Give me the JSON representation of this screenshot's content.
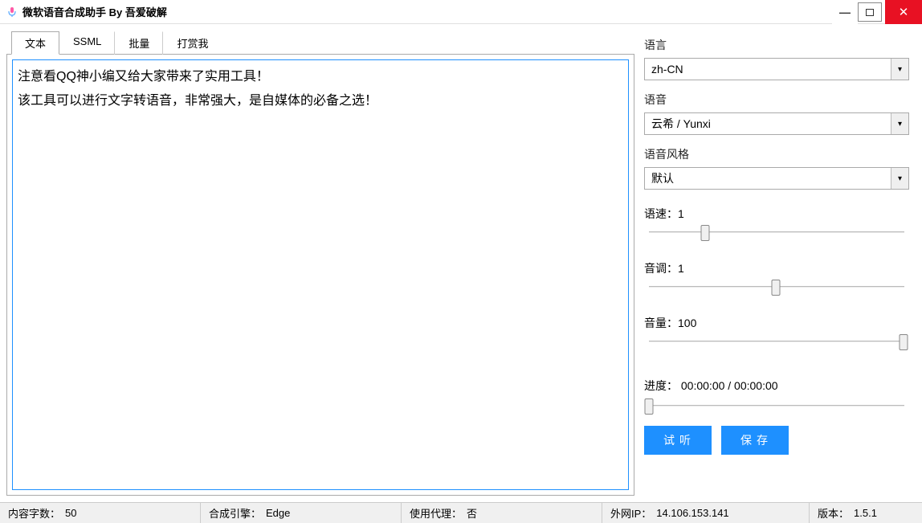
{
  "window": {
    "title": "微软语音合成助手 By 吾爱破解"
  },
  "tabs": [
    {
      "label": "文本"
    },
    {
      "label": "SSML"
    },
    {
      "label": "批量"
    },
    {
      "label": "打赏我"
    }
  ],
  "editor": {
    "text": "注意看QQ神小编又给大家带来了实用工具！\n该工具可以进行文字转语音，非常强大，是自媒体的必备之选！"
  },
  "sidebar": {
    "language": {
      "label": "语言",
      "value": "zh-CN"
    },
    "voice": {
      "label": "语音",
      "value": "云希 / Yunxi"
    },
    "style": {
      "label": "语音风格",
      "value": "默认"
    },
    "rate": {
      "label": "语速：",
      "value": "1",
      "pct": 22
    },
    "pitch": {
      "label": "音调：",
      "value": "1",
      "pct": 50
    },
    "volume": {
      "label": "音量：",
      "value": "100",
      "pct": 100
    },
    "progress": {
      "label": "进度：",
      "value": "00:00:00 / 00:00:00",
      "pct": 0
    },
    "buttons": {
      "preview": "试听",
      "save": "保存"
    }
  },
  "status": {
    "chars": {
      "label": "内容字数：",
      "value": "50"
    },
    "engine": {
      "label": "合成引擎：",
      "value": "Edge"
    },
    "proxy": {
      "label": "使用代理：",
      "value": "否"
    },
    "ip": {
      "label": "外网IP：",
      "value": "14.106.153.141"
    },
    "version": {
      "label": "版本：",
      "value": "1.5.1"
    }
  }
}
